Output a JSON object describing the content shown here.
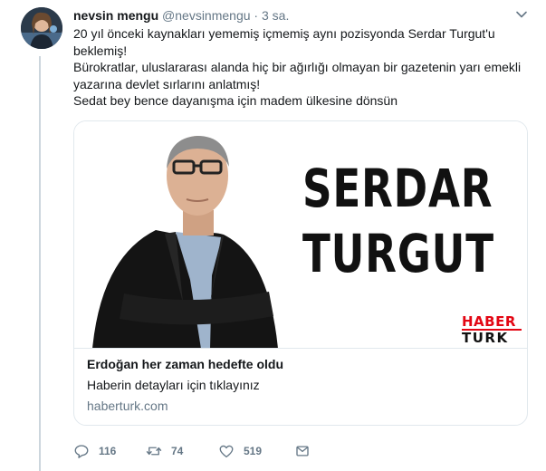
{
  "author": {
    "name": "nevsin mengu",
    "handle": "@nevsinmengu",
    "separator": "·",
    "time": "3 sa."
  },
  "tweet": {
    "lines": [
      "20 yıl önceki kaynakları yememiş içmemiş aynı pozisyonda Serdar Turgut'u beklemiş!",
      "Bürokratlar, uluslararası alanda hiç bir ağırlığı olmayan bir gazetenin yarı emekli yazarına devlet sırlarını anlatmış!",
      "Sedat bey bence dayanışma için madem ülkesine dönsün"
    ]
  },
  "card": {
    "image_text_line1": "SERDAR",
    "image_text_line2": "TURGUT",
    "logo_top": "HABER",
    "logo_bottom": "TURK",
    "headline": "Erdoğan her zaman hedefte oldu",
    "description": "Haberin detayları için tıklayınız",
    "domain": "haberturk.com"
  },
  "actions": {
    "replies": "116",
    "retweets": "74",
    "likes": "519"
  },
  "icons": {
    "reply": "reply-icon",
    "retweet": "retweet-icon",
    "like": "heart-icon",
    "dm": "envelope-icon",
    "menu": "chevron-down-icon"
  },
  "colors": {
    "text": "#14171a",
    "secondary": "#657786",
    "border": "#e1e8ed",
    "logo_red": "#e30613"
  }
}
